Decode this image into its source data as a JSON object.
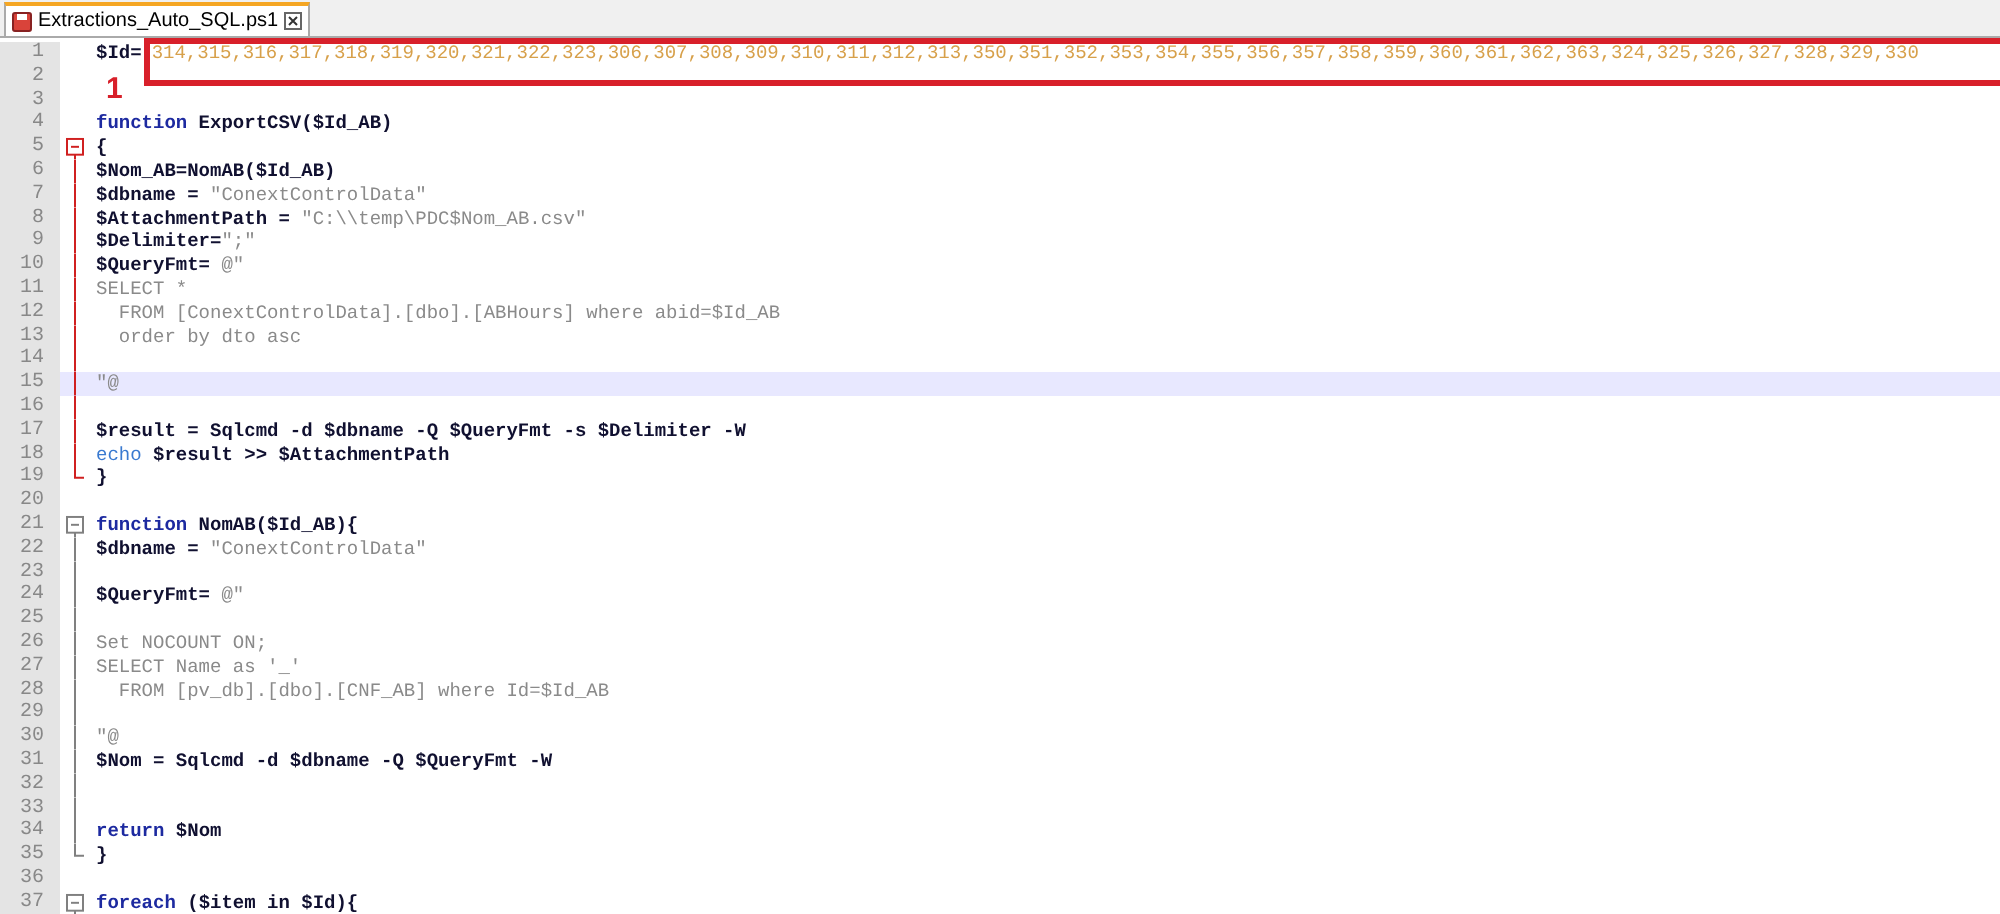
{
  "tabs": [
    {
      "label": "Extractions_Auto_SQL.ps1",
      "selected": true,
      "unsaved": true
    }
  ],
  "annotation": {
    "label": "1"
  },
  "lines": [
    {
      "number": "1",
      "tokens": [
        {
          "kind": "var",
          "text": "$Id="
        },
        {
          "kind": "num",
          "text": "314,315,316,317,318,319,320,321,322,323,306,307,308,309,310,311,312,313,350,351,352,353,354,355,356,357,358,359,360,361,362,363,324,325,326,327,328,329,330"
        }
      ]
    },
    {
      "number": "2"
    },
    {
      "number": "3"
    },
    {
      "number": "4",
      "tokens": [
        {
          "kind": "kw",
          "text": "function"
        },
        {
          "kind": "plain",
          "text": " ExportCSV($Id_AB)"
        }
      ]
    },
    {
      "number": "5",
      "kind": "block-start",
      "active": true,
      "tokens": [
        {
          "kind": "plain",
          "text": "{"
        }
      ]
    },
    {
      "number": "6",
      "kind": "block-body",
      "active": true,
      "tokens": [
        {
          "kind": "plain",
          "text": "$Nom_AB=NomAB($Id_AB)"
        }
      ]
    },
    {
      "number": "7",
      "kind": "block-body",
      "active": true,
      "tokens": [
        {
          "kind": "plain",
          "text": "$dbname = "
        },
        {
          "kind": "str",
          "text": "\"ConextControlData\""
        }
      ]
    },
    {
      "number": "8",
      "kind": "block-body",
      "active": true,
      "tokens": [
        {
          "kind": "plain",
          "text": "$AttachmentPath = "
        },
        {
          "kind": "str",
          "text": "\"C:\\\\temp\\PDC$Nom_AB.csv\""
        }
      ]
    },
    {
      "number": "9",
      "kind": "block-body",
      "active": true,
      "tokens": [
        {
          "kind": "plain",
          "text": "$Delimiter="
        },
        {
          "kind": "str",
          "text": "\";\""
        }
      ]
    },
    {
      "number": "10",
      "kind": "block-body",
      "active": true,
      "tokens": [
        {
          "kind": "plain",
          "text": "$QueryFmt= "
        },
        {
          "kind": "str",
          "text": "@\""
        }
      ]
    },
    {
      "number": "11",
      "kind": "block-body",
      "active": true,
      "tokens": [
        {
          "kind": "str",
          "text": "SELECT *"
        }
      ]
    },
    {
      "number": "12",
      "kind": "block-body",
      "active": true,
      "tokens": [
        {
          "kind": "str",
          "text": "  FROM [ConextControlData].[dbo].[ABHours] where abid=$Id_AB"
        }
      ]
    },
    {
      "number": "13",
      "kind": "block-body",
      "active": true,
      "tokens": [
        {
          "kind": "str",
          "text": "  order by dto asc"
        }
      ]
    },
    {
      "number": "14",
      "kind": "block-body",
      "active": true
    },
    {
      "number": "15",
      "kind": "block-body",
      "active": true,
      "highlighted": true,
      "tokens": [
        {
          "kind": "str",
          "text": "\"@"
        }
      ]
    },
    {
      "number": "16",
      "kind": "block-body",
      "active": true
    },
    {
      "number": "17",
      "kind": "block-body",
      "active": true,
      "tokens": [
        {
          "kind": "plain",
          "text": "$result = Sqlcmd -d $dbname -Q $QueryFmt -s $Delimiter -W"
        }
      ]
    },
    {
      "number": "18",
      "kind": "block-body",
      "active": true,
      "tokens": [
        {
          "kind": "cmd",
          "text": "echo"
        },
        {
          "kind": "plain",
          "text": " $result >> $AttachmentPath"
        }
      ]
    },
    {
      "number": "19",
      "kind": "block-end",
      "active": true,
      "tokens": [
        {
          "kind": "plain",
          "text": "}"
        }
      ]
    },
    {
      "number": "20"
    },
    {
      "number": "21",
      "kind": "block-start",
      "active": false,
      "tokens": [
        {
          "kind": "kw",
          "text": "function"
        },
        {
          "kind": "plain",
          "text": " NomAB($Id_AB){"
        }
      ]
    },
    {
      "number": "22",
      "kind": "block-body",
      "active": false,
      "tokens": [
        {
          "kind": "plain",
          "text": "$dbname = "
        },
        {
          "kind": "str",
          "text": "\"ConextControlData\""
        }
      ]
    },
    {
      "number": "23",
      "kind": "block-body",
      "active": false
    },
    {
      "number": "24",
      "kind": "block-body",
      "active": false,
      "tokens": [
        {
          "kind": "plain",
          "text": "$QueryFmt= "
        },
        {
          "kind": "str",
          "text": "@\""
        }
      ]
    },
    {
      "number": "25",
      "kind": "block-body",
      "active": false
    },
    {
      "number": "26",
      "kind": "block-body",
      "active": false,
      "tokens": [
        {
          "kind": "str",
          "text": "Set NOCOUNT ON;"
        }
      ]
    },
    {
      "number": "27",
      "kind": "block-body",
      "active": false,
      "tokens": [
        {
          "kind": "str",
          "text": "SELECT Name as '_'"
        }
      ]
    },
    {
      "number": "28",
      "kind": "block-body",
      "active": false,
      "tokens": [
        {
          "kind": "str",
          "text": "  FROM [pv_db].[dbo].[CNF_AB] where Id=$Id_AB"
        }
      ]
    },
    {
      "number": "29",
      "kind": "block-body",
      "active": false
    },
    {
      "number": "30",
      "kind": "block-body",
      "active": false,
      "tokens": [
        {
          "kind": "str",
          "text": "\"@"
        }
      ]
    },
    {
      "number": "31",
      "kind": "block-body",
      "active": false,
      "tokens": [
        {
          "kind": "plain",
          "text": "$Nom = Sqlcmd -d $dbname -Q $QueryFmt -W"
        }
      ]
    },
    {
      "number": "32",
      "kind": "block-body",
      "active": false
    },
    {
      "number": "33",
      "kind": "block-body",
      "active": false
    },
    {
      "number": "34",
      "kind": "block-body",
      "active": false,
      "tokens": [
        {
          "kind": "kw",
          "text": "return"
        },
        {
          "kind": "plain",
          "text": " $Nom"
        }
      ]
    },
    {
      "number": "35",
      "kind": "block-end",
      "active": false,
      "tokens": [
        {
          "kind": "plain",
          "text": "}"
        }
      ]
    },
    {
      "number": "36"
    },
    {
      "number": "37",
      "kind": "block-start",
      "active": false,
      "tokens": [
        {
          "kind": "kw",
          "text": "foreach"
        },
        {
          "kind": "plain",
          "text": " ($item in $Id){"
        }
      ]
    }
  ]
}
